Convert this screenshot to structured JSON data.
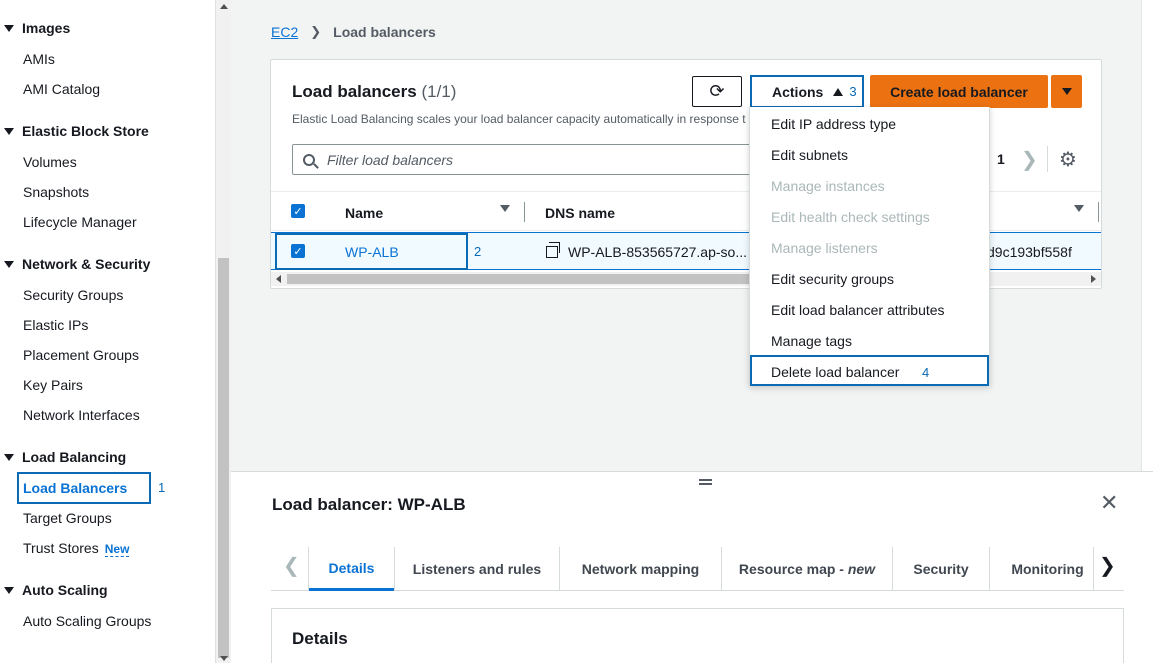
{
  "sidebar": {
    "sections": [
      {
        "title": "Images",
        "items": [
          "AMIs",
          "AMI Catalog"
        ]
      },
      {
        "title": "Elastic Block Store",
        "items": [
          "Volumes",
          "Snapshots",
          "Lifecycle Manager"
        ]
      },
      {
        "title": "Network & Security",
        "items": [
          "Security Groups",
          "Elastic IPs",
          "Placement Groups",
          "Key Pairs",
          "Network Interfaces"
        ]
      },
      {
        "title": "Load Balancing",
        "items": [
          "Load Balancers",
          "Target Groups",
          "Trust Stores"
        ]
      },
      {
        "title": "Auto Scaling",
        "items": [
          "Auto Scaling Groups"
        ]
      }
    ],
    "new_badge": "New",
    "active_item": "Load Balancers"
  },
  "annotations": {
    "step1": "1",
    "step2": "2",
    "step3": "3",
    "step4": "4"
  },
  "breadcrumb": {
    "root": "EC2",
    "current": "Load balancers"
  },
  "panel": {
    "title": "Load balancers",
    "count": "(1/1)",
    "description": "Elastic Load Balancing scales your load balancer capacity automatically in response t",
    "actions_label": "Actions",
    "create_label": "Create load balancer",
    "filter_placeholder": "Filter load balancers",
    "page": "1"
  },
  "table": {
    "columns": [
      "Name",
      "DNS name"
    ],
    "rows": [
      {
        "name": "WP-ALB",
        "dns": "WP-ALB-853565727.ap-so...",
        "id_fragment": "d9c193bf558f",
        "selected": true
      }
    ]
  },
  "actions_menu": [
    {
      "label": "Edit IP address type",
      "enabled": true
    },
    {
      "label": "Edit subnets",
      "enabled": true
    },
    {
      "label": "Manage instances",
      "enabled": false
    },
    {
      "label": "Edit health check settings",
      "enabled": false
    },
    {
      "label": "Manage listeners",
      "enabled": false
    },
    {
      "label": "Edit security groups",
      "enabled": true
    },
    {
      "label": "Edit load balancer attributes",
      "enabled": true
    },
    {
      "label": "Manage tags",
      "enabled": true
    },
    {
      "label": "Delete load balancer",
      "enabled": true,
      "highlighted": true
    }
  ],
  "details_panel": {
    "title": "Load balancer: WP-ALB",
    "tabs": [
      "Details",
      "Listeners and rules",
      "Network mapping",
      "Resource map",
      "Security",
      "Monitoring"
    ],
    "resource_map_suffix": "- new",
    "active_tab": "Details",
    "section_title": "Details"
  },
  "colors": {
    "accent": "#0972d3",
    "primary_button": "#ec7211",
    "annotation": "#0a6ab4"
  }
}
